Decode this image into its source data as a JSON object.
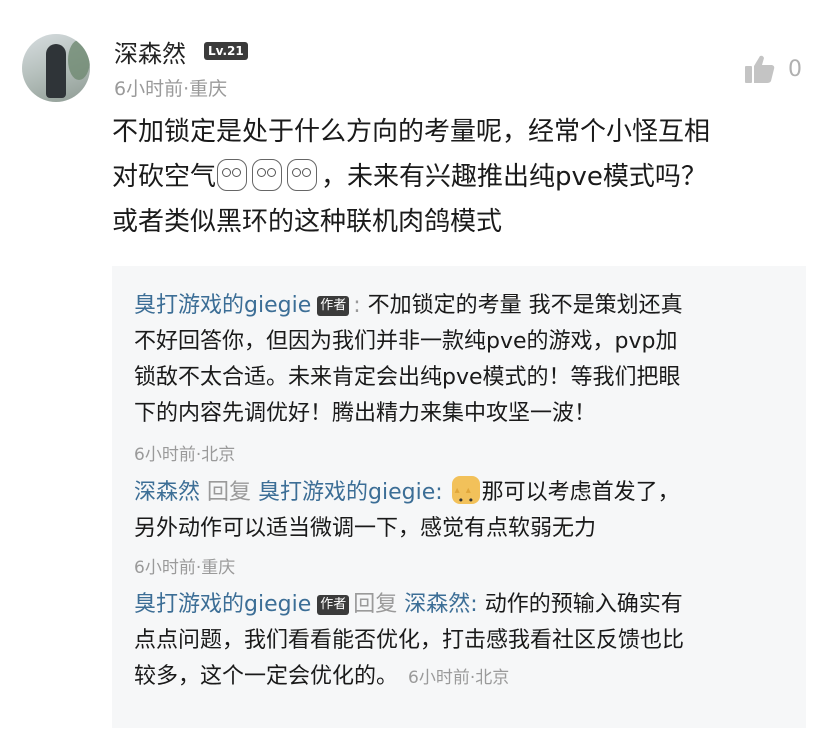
{
  "comment": {
    "username": "深森然",
    "level": "Lv.21",
    "time": "6小时前·重庆",
    "like_count": "0",
    "text_line1": "不加锁定是处于什么方向的考量呢，经常个小怪互相",
    "text_line2a": "对砍空气",
    "text_line2b": "，未来有兴趣推出纯pve模式吗？",
    "text_line3": "或者类似黑环的这种联机肉鸽模式"
  },
  "replies": [
    {
      "name": "臭打游戏的giegie",
      "badge": "作者",
      "line1_rest": "不加锁定的考量 我不是策划还真",
      "line2": "不好回答你，但因为我们并非一款纯pve的游戏，pvp加",
      "line3": "锁敌不太合适。未来肯定会出纯pve模式的！等我们把眼",
      "line4": "下的内容先调优好！腾出精力来集中攻坚一波！",
      "time": "6小时前·北京"
    },
    {
      "name": "深森然",
      "reply_word": "回复",
      "target": "臭打游戏的giegie:",
      "line1_rest": "那可以考虑首发了，",
      "line2": "另外动作可以适当微调一下，感觉有点软弱无力",
      "time": "6小时前·重庆"
    },
    {
      "name": "臭打游戏的giegie",
      "badge": "作者",
      "reply_word": "回复",
      "target": "深森然:",
      "line1_rest": "动作的预输入确实有",
      "line2": "点点问题，我们看看能否优化，打击感我看社区反馈也比",
      "line3": "较多，这个一定会优化的。",
      "time": "6小时前·北京"
    }
  ]
}
